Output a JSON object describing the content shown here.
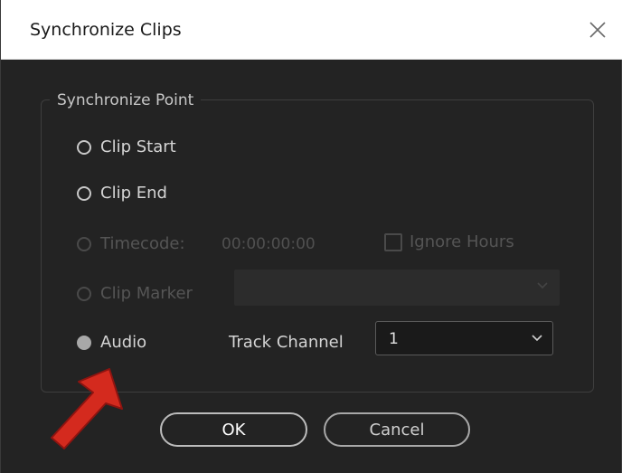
{
  "window": {
    "title": "Synchronize Clips"
  },
  "group": {
    "legend": "Synchronize Point"
  },
  "options": {
    "clip_start": "Clip Start",
    "clip_end": "Clip End",
    "timecode": "Timecode:",
    "timecode_value": "00:00:00:00",
    "ignore_hours": "Ignore Hours",
    "clip_marker": "Clip Marker",
    "audio": "Audio"
  },
  "track_channel": {
    "label": "Track Channel",
    "value": "1"
  },
  "buttons": {
    "ok": "OK",
    "cancel": "Cancel"
  },
  "colors": {
    "background": "#232323",
    "arrow": "#d42a1e",
    "titlebar": "#ffffff"
  }
}
